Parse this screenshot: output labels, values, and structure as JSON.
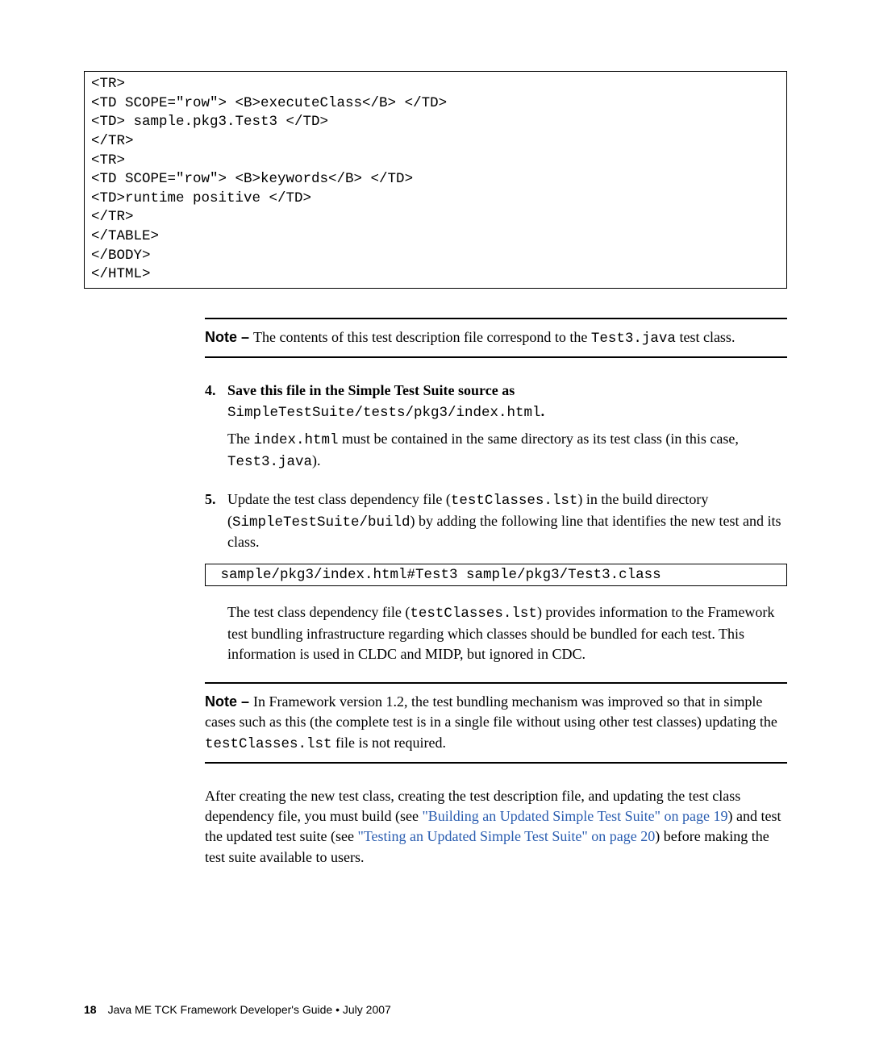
{
  "code_block": "<TR>\n<TD SCOPE=\"row\"> <B>executeClass</B> </TD>\n<TD> sample.pkg3.Test3 </TD>\n</TR>\n<TR>\n<TD SCOPE=\"row\"> <B>keywords</B> </TD>\n<TD>runtime positive </TD>\n</TR>\n</TABLE>\n</BODY>\n</HTML>",
  "note1": {
    "label": "Note – ",
    "before": "The contents of this test description file correspond to the ",
    "mono": "Test3.java",
    "after": " test class."
  },
  "step4": {
    "num": "4.",
    "head": "Save this file in the Simple Test Suite source as",
    "path": "SimpleTestSuite/tests/pkg3/index.html",
    "tail": "."
  },
  "step4_para": {
    "a": "The ",
    "m1": "index.html",
    "b": " must be contained in the same directory as its test class (in this case, ",
    "m2": "Test3.java",
    "c": ")."
  },
  "step5": {
    "num": "5.",
    "a": "Update the test class dependency file (",
    "m1": "testClasses.lst",
    "b": ") in the build directory (",
    "m2": "SimpleTestSuite/build",
    "c": ") by adding the following line that identifies the new test and its class."
  },
  "inline_code": " sample/pkg3/index.html#Test3 sample/pkg3/Test3.class",
  "step5_para": {
    "a": "The test class dependency file (",
    "m1": "testClasses.lst",
    "b": ") provides information to the Framework test bundling infrastructure regarding which classes should be bundled for each test. This information is used in CLDC and MIDP, but ignored in CDC."
  },
  "note2": {
    "label": "Note – ",
    "a": "In Framework version 1.2, the test bundling mechanism was improved so that in simple cases such as this (the complete test is in a single file without using other test classes) updating the ",
    "m1": "testClasses.lst",
    "b": " file is not required."
  },
  "final": {
    "a": "After creating the new test class, creating the test description file, and updating the test class dependency file, you must build (see ",
    "link1": "\"Building an Updated Simple Test Suite\" on page 19",
    "b": ") and test the updated test suite (see ",
    "link2": "\"Testing an Updated Simple Test Suite\" on page 20",
    "c": ") before making the test suite available to users."
  },
  "footer": {
    "page": "18",
    "text": "Java ME TCK Framework Developer's Guide  •  July 2007"
  }
}
